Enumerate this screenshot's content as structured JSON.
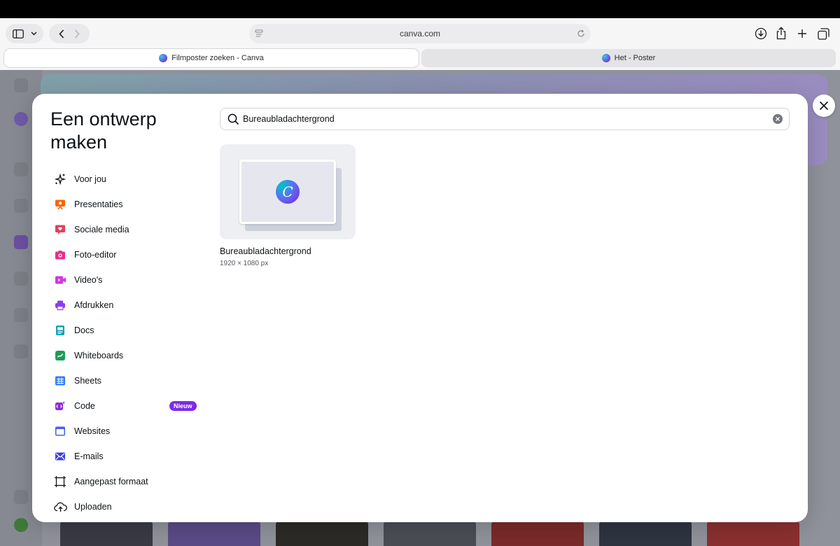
{
  "browser": {
    "url": "canva.com",
    "tabs": [
      {
        "title": "Filmposter zoeken - Canva",
        "active": true
      },
      {
        "title": "Het - Poster",
        "active": false
      }
    ]
  },
  "modal": {
    "title": "Een ontwerp maken",
    "search": {
      "value": "Bureaubladachtergrond"
    },
    "menu": [
      {
        "label": "Voor jou",
        "icon": "sparkle-icon",
        "color": "#0d1216"
      },
      {
        "label": "Presentaties",
        "icon": "presentation-icon",
        "color": "#ff6105"
      },
      {
        "label": "Sociale media",
        "icon": "heart-chat-icon",
        "color": "#e43f5a"
      },
      {
        "label": "Foto-editor",
        "icon": "camera-icon",
        "color": "#e8308b"
      },
      {
        "label": "Video's",
        "icon": "video-icon",
        "color": "#d633e8"
      },
      {
        "label": "Afdrukken",
        "icon": "printer-icon",
        "color": "#8e3cf0"
      },
      {
        "label": "Docs",
        "icon": "doc-icon",
        "color": "#13a3b5"
      },
      {
        "label": "Whiteboards",
        "icon": "whiteboard-icon",
        "color": "#1c9e55"
      },
      {
        "label": "Sheets",
        "icon": "sheet-icon",
        "color": "#2f7cf6"
      },
      {
        "label": "Code",
        "icon": "code-icon",
        "color": "#8b2fd6",
        "badge": "Nieuw"
      },
      {
        "label": "Websites",
        "icon": "website-icon",
        "color": "#4a5ef5"
      },
      {
        "label": "E-mails",
        "icon": "mail-icon",
        "color": "#3a42d8"
      },
      {
        "label": "Aangepast formaat",
        "icon": "custom-size-icon",
        "color": "#0d1216"
      },
      {
        "label": "Uploaden",
        "icon": "cloud-upload-icon",
        "color": "#0d1216"
      }
    ],
    "result": {
      "name": "Bureaubladachtergrond",
      "size": "1920 × 1080 px",
      "logo_letter": "C"
    }
  },
  "colors": {
    "brand": "#7d2ae8",
    "accent_teal": "#00c4cc"
  }
}
